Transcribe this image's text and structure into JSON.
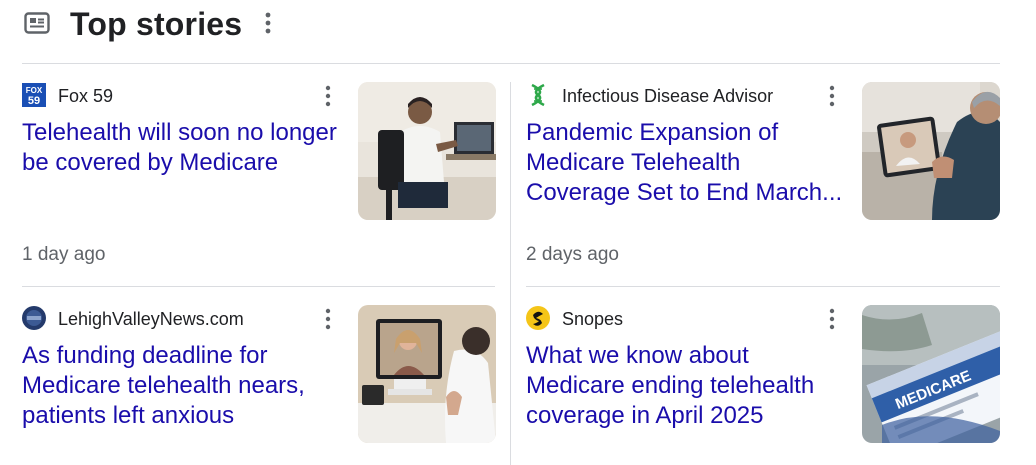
{
  "header": {
    "title": "Top stories",
    "icon": "newspaper-icon",
    "more_icon": "more-vert-icon"
  },
  "colors": {
    "headline": "#1a0dab",
    "meta": "#5f6368",
    "text": "#202124",
    "divider": "#dadce0"
  },
  "stories": [
    {
      "source": "Fox 59",
      "source_logo": "fox59-logo",
      "logo_text": "FOX 59",
      "headline": "Telehealth will soon no longer be covered by Medicare",
      "time": "1 day ago",
      "thumbnail": "doctor-video-call-photo"
    },
    {
      "source": "Infectious Disease Advisor",
      "source_logo": "dna-logo",
      "headline": "Pandemic Expansion of Medicare Telehealth Coverage Set to End March...",
      "time": "2 days ago",
      "thumbnail": "tablet-video-call-photo"
    },
    {
      "source": "LehighValleyNews.com",
      "source_logo": "lehighvalley-logo",
      "headline": "As funding deadline for Medicare telehealth nears, patients left anxious",
      "time": "",
      "thumbnail": "patient-monitor-photo"
    },
    {
      "source": "Snopes",
      "source_logo": "snopes-logo",
      "headline": "What we know about Medicare ending telehealth coverage in April 2025",
      "time": "",
      "thumbnail": "medicare-card-photo",
      "thumbnail_text": "MEDICARE"
    }
  ]
}
